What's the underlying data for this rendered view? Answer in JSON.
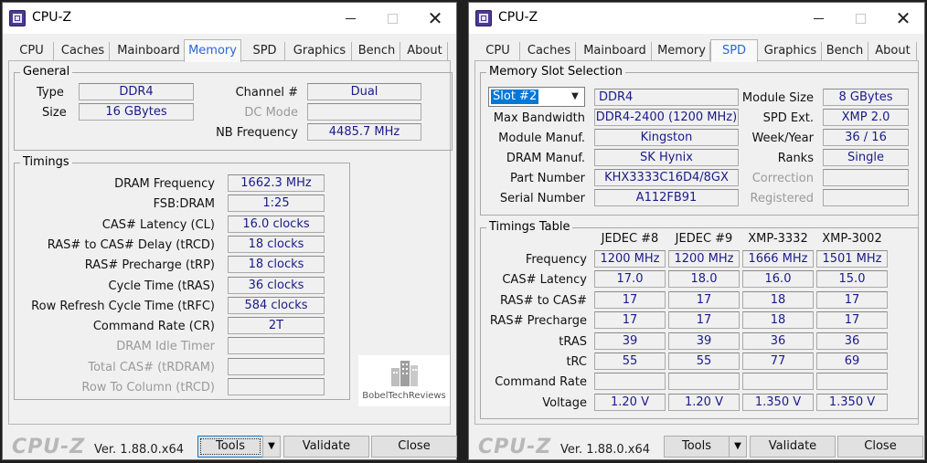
{
  "left": {
    "title": "CPU-Z",
    "tabs": [
      "CPU",
      "Caches",
      "Mainboard",
      "Memory",
      "SPD",
      "Graphics",
      "Bench",
      "About"
    ],
    "active_tab": "Memory",
    "general": {
      "title": "General",
      "type_label": "Type",
      "type_value": "DDR4",
      "size_label": "Size",
      "size_value": "16 GBytes",
      "channel_label": "Channel #",
      "channel_value": "Dual",
      "dc_mode_label": "DC Mode",
      "dc_mode_value": "",
      "nb_freq_label": "NB Frequency",
      "nb_freq_value": "4485.7 MHz"
    },
    "timings": {
      "title": "Timings",
      "rows": [
        {
          "label": "DRAM Frequency",
          "value": "1662.3 MHz",
          "enabled": true
        },
        {
          "label": "FSB:DRAM",
          "value": "1:25",
          "enabled": true
        },
        {
          "label": "CAS# Latency (CL)",
          "value": "16.0 clocks",
          "enabled": true
        },
        {
          "label": "RAS# to CAS# Delay (tRCD)",
          "value": "18 clocks",
          "enabled": true
        },
        {
          "label": "RAS# Precharge (tRP)",
          "value": "18 clocks",
          "enabled": true
        },
        {
          "label": "Cycle Time (tRAS)",
          "value": "36 clocks",
          "enabled": true
        },
        {
          "label": "Row Refresh Cycle Time (tRFC)",
          "value": "584 clocks",
          "enabled": true
        },
        {
          "label": "Command Rate (CR)",
          "value": "2T",
          "enabled": true
        },
        {
          "label": "DRAM Idle Timer",
          "value": "",
          "enabled": false
        },
        {
          "label": "Total CAS# (tRDRAM)",
          "value": "",
          "enabled": false
        },
        {
          "label": "Row To Column (tRCD)",
          "value": "",
          "enabled": false
        }
      ]
    },
    "watermark": "BobelTechReviews",
    "brand": "CPU-Z",
    "version": "Ver. 1.88.0.x64",
    "tools_label": "Tools",
    "validate_label": "Validate",
    "close_label": "Close"
  },
  "right": {
    "title": "CPU-Z",
    "tabs": [
      "CPU",
      "Caches",
      "Mainboard",
      "Memory",
      "SPD",
      "Graphics",
      "Bench",
      "About"
    ],
    "active_tab": "SPD",
    "slot": {
      "title": "Memory Slot Selection",
      "selected": "Slot #2",
      "type_value": "DDR4",
      "module_size_label": "Module Size",
      "module_size_value": "8 GBytes",
      "max_bw_label": "Max Bandwidth",
      "max_bw_value": "DDR4-2400 (1200 MHz)",
      "spd_ext_label": "SPD Ext.",
      "spd_ext_value": "XMP 2.0",
      "module_manuf_label": "Module Manuf.",
      "module_manuf_value": "Kingston",
      "week_year_label": "Week/Year",
      "week_year_value": "36 / 16",
      "dram_manuf_label": "DRAM Manuf.",
      "dram_manuf_value": "SK Hynix",
      "ranks_label": "Ranks",
      "ranks_value": "Single",
      "part_number_label": "Part Number",
      "part_number_value": "KHX3333C16D4/8GX",
      "correction_label": "Correction",
      "correction_value": "",
      "serial_label": "Serial Number",
      "serial_value": "A112FB91",
      "registered_label": "Registered",
      "registered_value": ""
    },
    "timings_table": {
      "title": "Timings Table",
      "columns": [
        "JEDEC #8",
        "JEDEC #9",
        "XMP-3332",
        "XMP-3002"
      ],
      "rows": [
        {
          "label": "Frequency",
          "values": [
            "1200 MHz",
            "1200 MHz",
            "1666 MHz",
            "1501 MHz"
          ]
        },
        {
          "label": "CAS# Latency",
          "values": [
            "17.0",
            "18.0",
            "16.0",
            "15.0"
          ]
        },
        {
          "label": "RAS# to CAS#",
          "values": [
            "17",
            "17",
            "18",
            "17"
          ]
        },
        {
          "label": "RAS# Precharge",
          "values": [
            "17",
            "17",
            "18",
            "17"
          ]
        },
        {
          "label": "tRAS",
          "values": [
            "39",
            "39",
            "36",
            "36"
          ]
        },
        {
          "label": "tRC",
          "values": [
            "55",
            "55",
            "77",
            "69"
          ]
        },
        {
          "label": "Command Rate",
          "values": [
            "",
            "",
            "",
            ""
          ]
        },
        {
          "label": "Voltage",
          "values": [
            "1.20 V",
            "1.20 V",
            "1.350 V",
            "1.350 V"
          ]
        }
      ]
    },
    "brand": "CPU-Z",
    "version": "Ver. 1.88.0.x64",
    "tools_label": "Tools",
    "validate_label": "Validate",
    "close_label": "Close"
  },
  "colors": {
    "value_text": "#1a1a8a",
    "active_tab_text": "#2a66d8",
    "selection": "#0078d7"
  }
}
